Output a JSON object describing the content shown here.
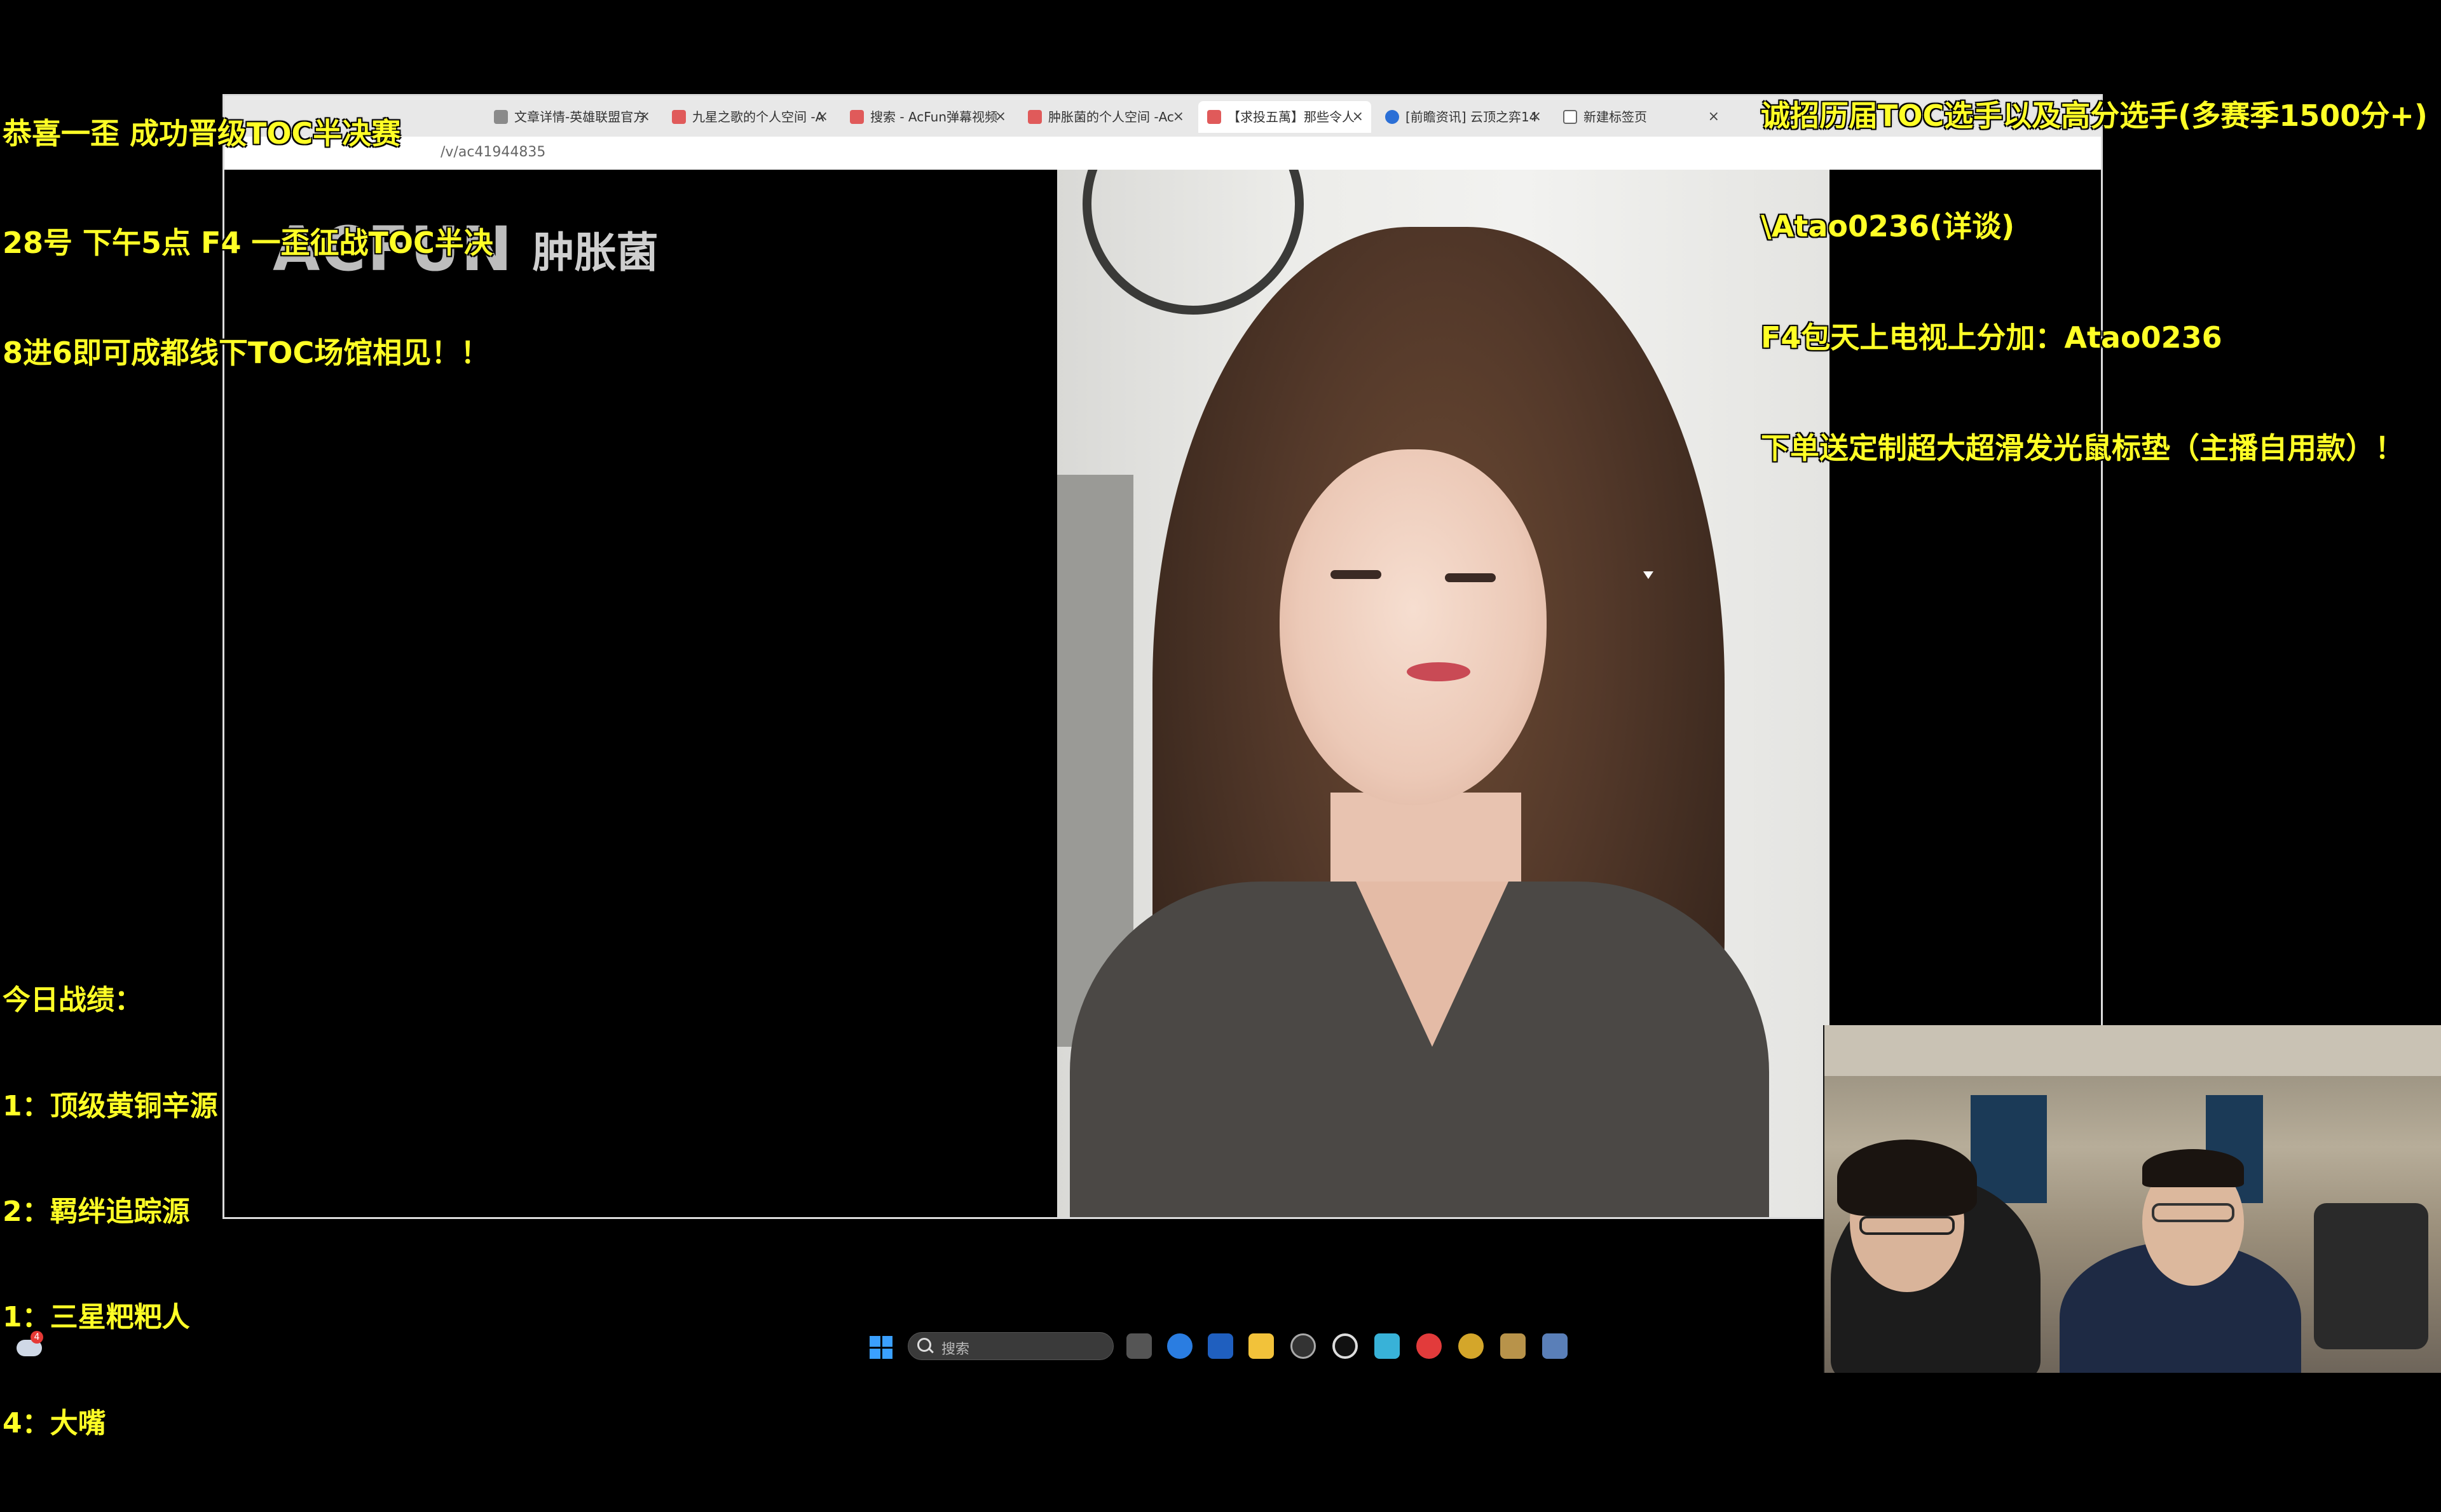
{
  "overlay": {
    "left_top": [
      "恭喜一歪 成功晋级TOC半决赛",
      "28号 下午5点 F4 一歪征战TOC半决",
      "8进6即可成都线下TOC场馆相见！！"
    ],
    "right_top": [
      "诚招历届TOC选手以及高分选手(多赛季1500分+)",
      "\\Atao0236(详谈)",
      "F4包天上电视上分加：Atao0236",
      "下单送定制超大超滑发光鼠标垫（主播自用款）！"
    ],
    "stats_title": "今日战绩：",
    "stats": [
      "1：顶级黄铜辛源",
      "2：羁绊追踪源",
      "1：三星粑粑人",
      "4：大嘴"
    ]
  },
  "browser": {
    "tabs": [
      {
        "label": "文章详情-英雄联盟官方",
        "fav": "gray"
      },
      {
        "label": "九星之歌的个人空间 -A",
        "fav": "red"
      },
      {
        "label": "搜索 - AcFun弹幕视频",
        "fav": "red"
      },
      {
        "label": "肿胀菌的个人空间 -Ac",
        "fav": "red"
      },
      {
        "label": "【求投五萬】那些令人",
        "fav": "red",
        "active": true
      },
      {
        "label": "[前瞻资讯] 云顶之弈14",
        "fav": "blue"
      },
      {
        "label": "新建标签页",
        "fav": "white"
      }
    ],
    "tab_close": "×",
    "window_close": "×",
    "url": "/v/ac41944835"
  },
  "video": {
    "logo_mark": "ACFUN",
    "logo_name": "肿胀菌"
  },
  "taskbar": {
    "search_placeholder": "搜索",
    "weather_badge": "4",
    "icons": [
      "task-view-icon",
      "browser-icon",
      "store-icon",
      "file-explorer-icon",
      "game-icon",
      "obs-icon",
      "notepad-icon",
      "netease-music-icon",
      "lol-client-icon",
      "league-icon",
      "tft-icon"
    ]
  },
  "colors": {
    "overlay_text": "#ffff26",
    "background": "#000000",
    "accent_blue": "#3aa0ff"
  }
}
